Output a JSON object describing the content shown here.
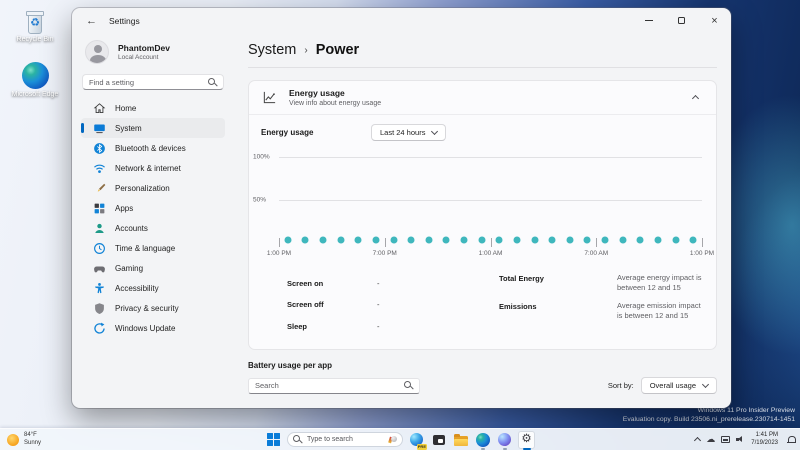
{
  "window": {
    "title": "Settings",
    "controls": {
      "minimize": "minimize",
      "maximize": "maximize",
      "close": "×"
    }
  },
  "account": {
    "name": "PhantomDev",
    "type": "Local Account"
  },
  "sidebar": {
    "search_placeholder": "Find a setting",
    "items": [
      {
        "label": "Home",
        "icon": "home",
        "selected": false
      },
      {
        "label": "System",
        "icon": "system",
        "selected": true
      },
      {
        "label": "Bluetooth & devices",
        "icon": "bluetooth",
        "selected": false
      },
      {
        "label": "Network & internet",
        "icon": "network",
        "selected": false
      },
      {
        "label": "Personalization",
        "icon": "personalization",
        "selected": false
      },
      {
        "label": "Apps",
        "icon": "apps",
        "selected": false
      },
      {
        "label": "Accounts",
        "icon": "accounts",
        "selected": false
      },
      {
        "label": "Time & language",
        "icon": "time",
        "selected": false
      },
      {
        "label": "Gaming",
        "icon": "gaming",
        "selected": false
      },
      {
        "label": "Accessibility",
        "icon": "accessibility",
        "selected": false
      },
      {
        "label": "Privacy & security",
        "icon": "privacy",
        "selected": false
      },
      {
        "label": "Windows Update",
        "icon": "update",
        "selected": false
      }
    ]
  },
  "breadcrumb": {
    "parent": "System",
    "separator": "›",
    "current": "Power"
  },
  "energy_card": {
    "title": "Energy usage",
    "subtitle": "View info about energy usage",
    "control_label": "Energy usage",
    "range_dropdown": "Last 24 hours",
    "stats_left": [
      {
        "label": "Screen on",
        "value": "-"
      },
      {
        "label": "Screen off",
        "value": "-"
      },
      {
        "label": "Sleep",
        "value": "-"
      }
    ],
    "stats_right": [
      {
        "label": "Total Energy",
        "value": "Average energy impact is between 12 and 15"
      },
      {
        "label": "Emissions",
        "value": "Average emission impact is between 12 and 15"
      }
    ]
  },
  "chart_data": {
    "type": "scatter",
    "title": "Energy usage (last 24 hours)",
    "x_tick_labels": [
      "1:00 PM",
      "7:00 PM",
      "1:00 AM",
      "7:00 AM",
      "1:00 PM"
    ],
    "y_tick_labels": [
      "100%",
      "50%"
    ],
    "y_tick_values": [
      100,
      50
    ],
    "ylim": [
      0,
      100
    ],
    "grid": true,
    "point_color": "#3fb7bd",
    "values": [
      3,
      3,
      3,
      3,
      3,
      3,
      3,
      3,
      3,
      3,
      3,
      3,
      3,
      3,
      3,
      3,
      3,
      3,
      3,
      3,
      3,
      3,
      3,
      3
    ]
  },
  "battery_section": {
    "title": "Battery usage per app",
    "search_placeholder": "Search",
    "sort_label": "Sort by:",
    "sort_value": "Overall usage"
  },
  "desktop": {
    "icons": [
      {
        "label": "Recycle Bin",
        "icon": "recycle-bin"
      },
      {
        "label": "Microsoft Edge",
        "icon": "edge"
      }
    ],
    "watermark": [
      "Windows 11 Pro Insider Preview",
      "Evaluation copy. Build 23506.ni_prerelease.230714-1451"
    ]
  },
  "widgets": {
    "temperature": "84°F",
    "condition": "Sunny"
  },
  "taskbar": {
    "search_placeholder": "Type to search",
    "copilot_badge": "PRE",
    "icons": [
      "start",
      "search",
      "copilot-preview",
      "task-view",
      "file-explorer",
      "edge",
      "edge-beta",
      "settings"
    ],
    "tray": {
      "time": "1:41 PM",
      "date": "7/19/2023"
    }
  },
  "colors": {
    "accent": "#0067c0",
    "dot_teal": "#3fb7bd",
    "card_bg": "#fbfbfd"
  }
}
